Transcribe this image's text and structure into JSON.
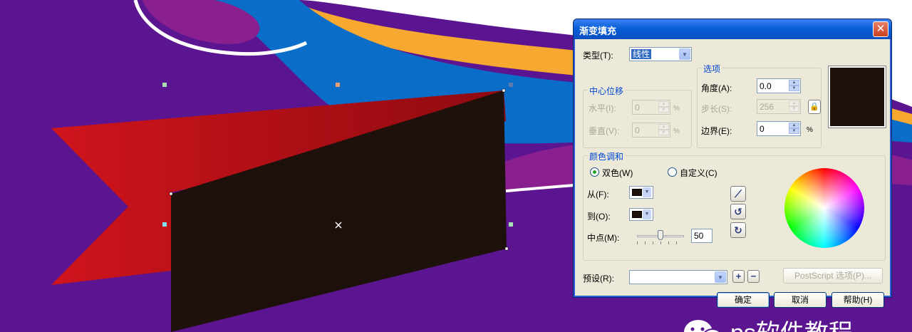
{
  "dialog": {
    "title": "渐变填充",
    "close_glyph": "✕",
    "type_label": "类型(T):",
    "type_value": "线性",
    "center_offset": {
      "title": "中心位移",
      "horizontal_label": "水平(I):",
      "horizontal_value": "0",
      "vertical_label": "垂直(V):",
      "vertical_value": "0",
      "unit": "%"
    },
    "options": {
      "title": "选项",
      "angle_label": "角度(A):",
      "angle_value": "0.0",
      "steps_label": "步长(S):",
      "steps_value": "256",
      "edge_label": "边界(E):",
      "edge_value": "0",
      "edge_unit": "%"
    },
    "preview_color": "#1e100a",
    "color_blend": {
      "title": "颜色调和",
      "two_color_label": "双色(W)",
      "two_color_selected": true,
      "custom_label": "自定义(C)",
      "custom_selected": false,
      "from_label": "从(F):",
      "from_color": "#1e100a",
      "to_label": "到(O):",
      "to_color": "#1e100a",
      "midpoint_label": "中点(M):",
      "midpoint_value": "50",
      "midpoint_fraction": 0.5
    },
    "presets_label": "预设(R):",
    "presets_value": "",
    "postscript_label": "PostScript 选项(P)...",
    "ok_label": "确定",
    "cancel_label": "取消",
    "help_label": "帮助(H)"
  },
  "watermark": "ps软件教程",
  "colors": {
    "background_purple": "#5b1590",
    "ribbon_red": "#c8101a",
    "panel_brown": "#1e100a",
    "accent_blue": "#0a6ec8",
    "accent_orange": "#f7a830"
  }
}
